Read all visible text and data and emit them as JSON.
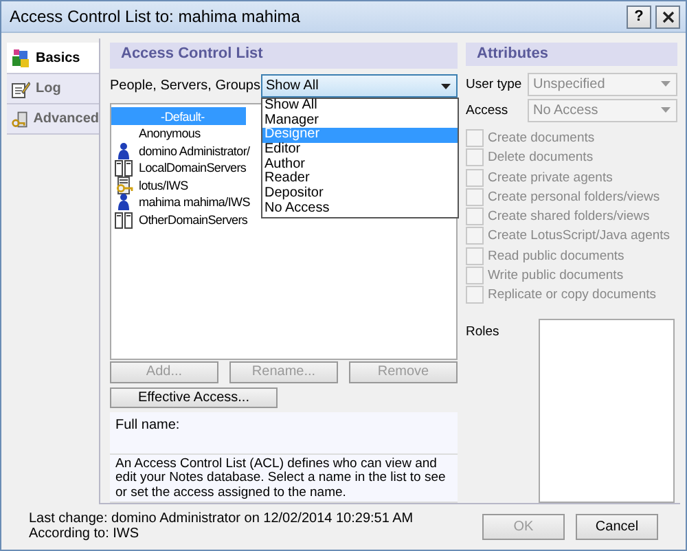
{
  "window": {
    "title": "Access Control List to: mahima mahima",
    "help_button": "?"
  },
  "tabs": [
    {
      "label": "Basics",
      "selected": true,
      "kind": "blocks"
    },
    {
      "label": "Log",
      "selected": false,
      "kind": "notepad"
    },
    {
      "label": "Advanced",
      "selected": false,
      "kind": "key"
    }
  ],
  "acl": {
    "header": "Access Control List",
    "filter_label": "People, Servers, Groups",
    "filter_value": "Show All",
    "filter_options": [
      {
        "label": "Show All",
        "selected": false
      },
      {
        "label": "Manager",
        "selected": false
      },
      {
        "label": "Designer",
        "selected": true
      },
      {
        "label": "Editor",
        "selected": false
      },
      {
        "label": "Author",
        "selected": false
      },
      {
        "label": "Reader",
        "selected": false
      },
      {
        "label": "Depositor",
        "selected": false
      },
      {
        "label": "No Access",
        "selected": false
      }
    ],
    "entries": [
      {
        "name": "-Default-",
        "kind": "none",
        "selected": true
      },
      {
        "name": "Anonymous",
        "kind": "none",
        "selected": false
      },
      {
        "name": "domino Administrator/",
        "kind": "person",
        "selected": false
      },
      {
        "name": "LocalDomainServers",
        "kind": "group",
        "selected": false
      },
      {
        "name": "lotus/IWS",
        "kind": "server",
        "selected": false
      },
      {
        "name": "mahima mahima/IWS",
        "kind": "person",
        "selected": false
      },
      {
        "name": "OtherDomainServers",
        "kind": "group",
        "selected": false
      }
    ],
    "buttons": [
      {
        "label": "Add...",
        "disabled": true
      },
      {
        "label": "Rename...",
        "disabled": true
      },
      {
        "label": "Remove",
        "disabled": true
      }
    ],
    "effective_access": "Effective Access...",
    "full_name_label": "Full name:",
    "description": "An Access Control List (ACL) defines who can view and edit your Notes database.  Select a name in the list to see or set the access assigned to the name."
  },
  "attributes": {
    "header": "Attributes",
    "user_type": {
      "label": "User type",
      "value": "Unspecified",
      "disabled": true
    },
    "access": {
      "label": "Access",
      "value": "No Access",
      "disabled": true
    },
    "permissions": [
      {
        "label": "Create documents",
        "checked": false,
        "disabled": true
      },
      {
        "label": "Delete documents",
        "checked": false,
        "disabled": true
      },
      {
        "label": "Create private agents",
        "checked": false,
        "disabled": true
      },
      {
        "label": "Create personal folders/views",
        "checked": false,
        "disabled": true
      },
      {
        "label": "Create shared folders/views",
        "checked": false,
        "disabled": true
      },
      {
        "label": "Create LotusScript/Java agents",
        "checked": false,
        "disabled": true
      },
      {
        "label": "Read public documents",
        "checked": false,
        "disabled": true
      },
      {
        "label": "Write public documents",
        "checked": false,
        "disabled": true
      },
      {
        "label": "Replicate or copy documents",
        "checked": false,
        "disabled": true
      }
    ],
    "roles_label": "Roles"
  },
  "footer": {
    "last_change": "Last change: domino Administrator on 12/02/2014 10:29:51 AM",
    "according_to": "According to: IWS"
  },
  "dialog_buttons": [
    {
      "label": "OK",
      "disabled": true
    },
    {
      "label": "Cancel",
      "disabled": false
    }
  ]
}
